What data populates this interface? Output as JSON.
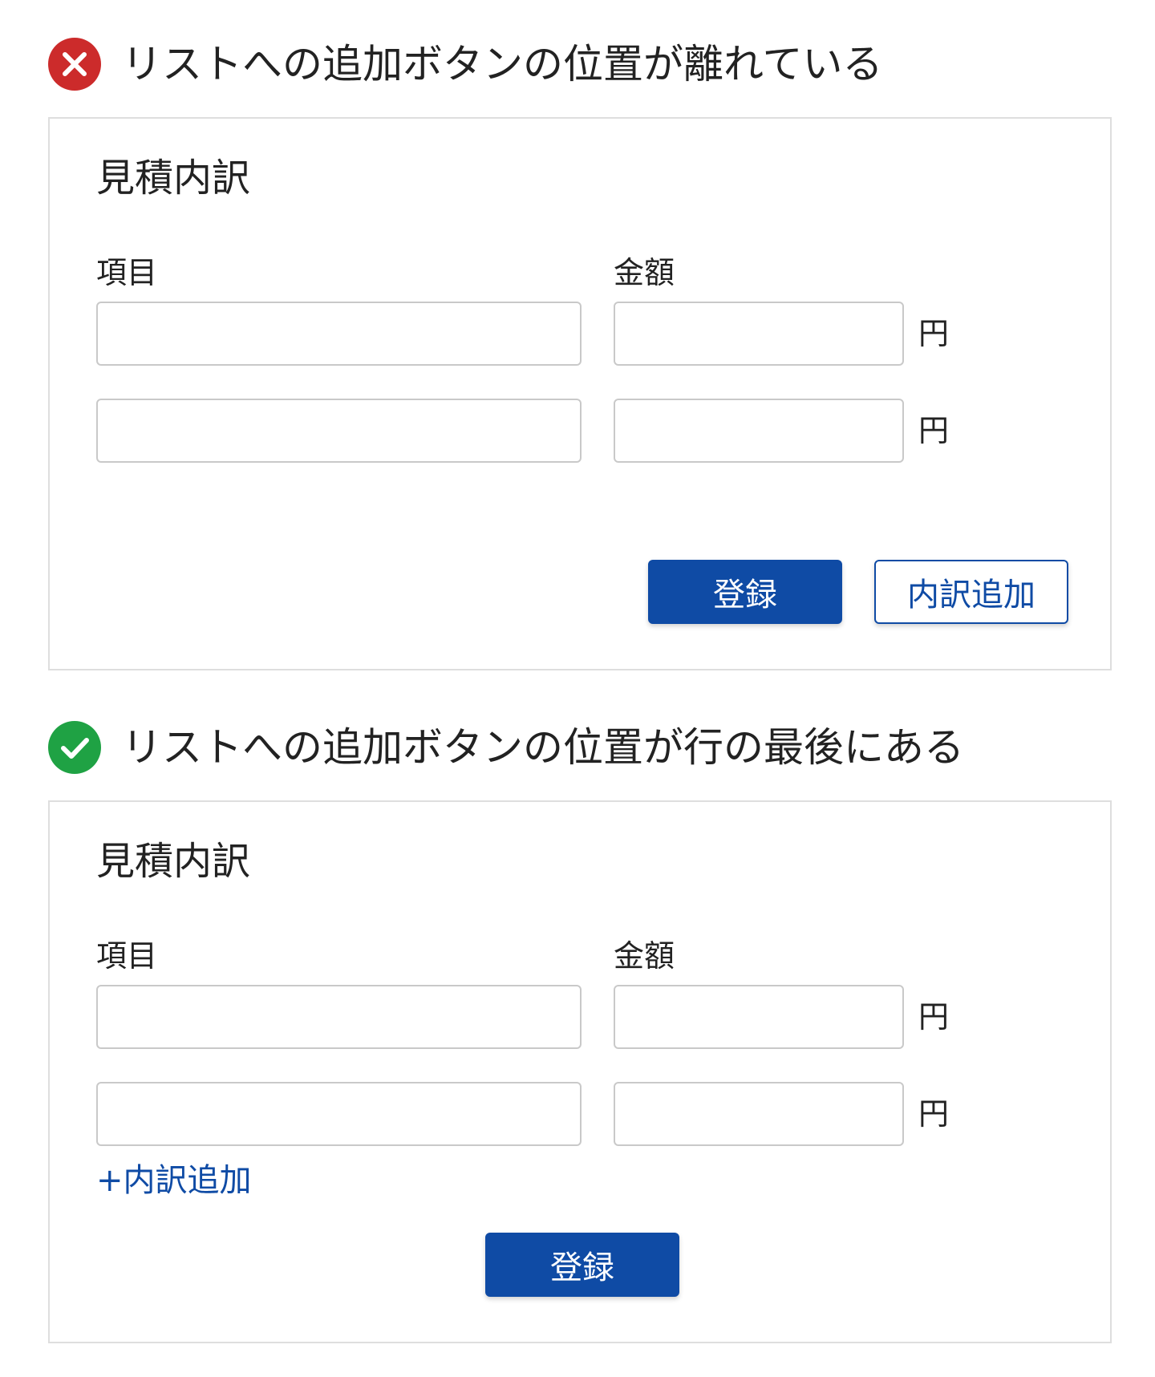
{
  "bad_example": {
    "heading": "リストへの追加ボタンの位置が離れている",
    "icon": "error-x-icon",
    "icon_color": "#cc2b2b",
    "card": {
      "title": "見積内訳",
      "item_label": "項目",
      "amount_label": "金額",
      "rows": [
        {
          "item_value": "",
          "amount_value": "",
          "unit": "円"
        },
        {
          "item_value": "",
          "amount_value": "",
          "unit": "円"
        }
      ],
      "submit_label": "登録",
      "add_label": "内訳追加"
    }
  },
  "good_example": {
    "heading": "リストへの追加ボタンの位置が行の最後にある",
    "icon": "success-check-icon",
    "icon_color": "#1fa244",
    "card": {
      "title": "見積内訳",
      "item_label": "項目",
      "amount_label": "金額",
      "rows": [
        {
          "item_value": "",
          "amount_value": "",
          "unit": "円"
        },
        {
          "item_value": "",
          "amount_value": "",
          "unit": "円"
        }
      ],
      "add_link_label": "+内訳追加",
      "submit_label": "登録"
    }
  },
  "colors": {
    "primary": "#0f4ba5",
    "border": "#dedede",
    "input_border": "#c9c9c9"
  }
}
